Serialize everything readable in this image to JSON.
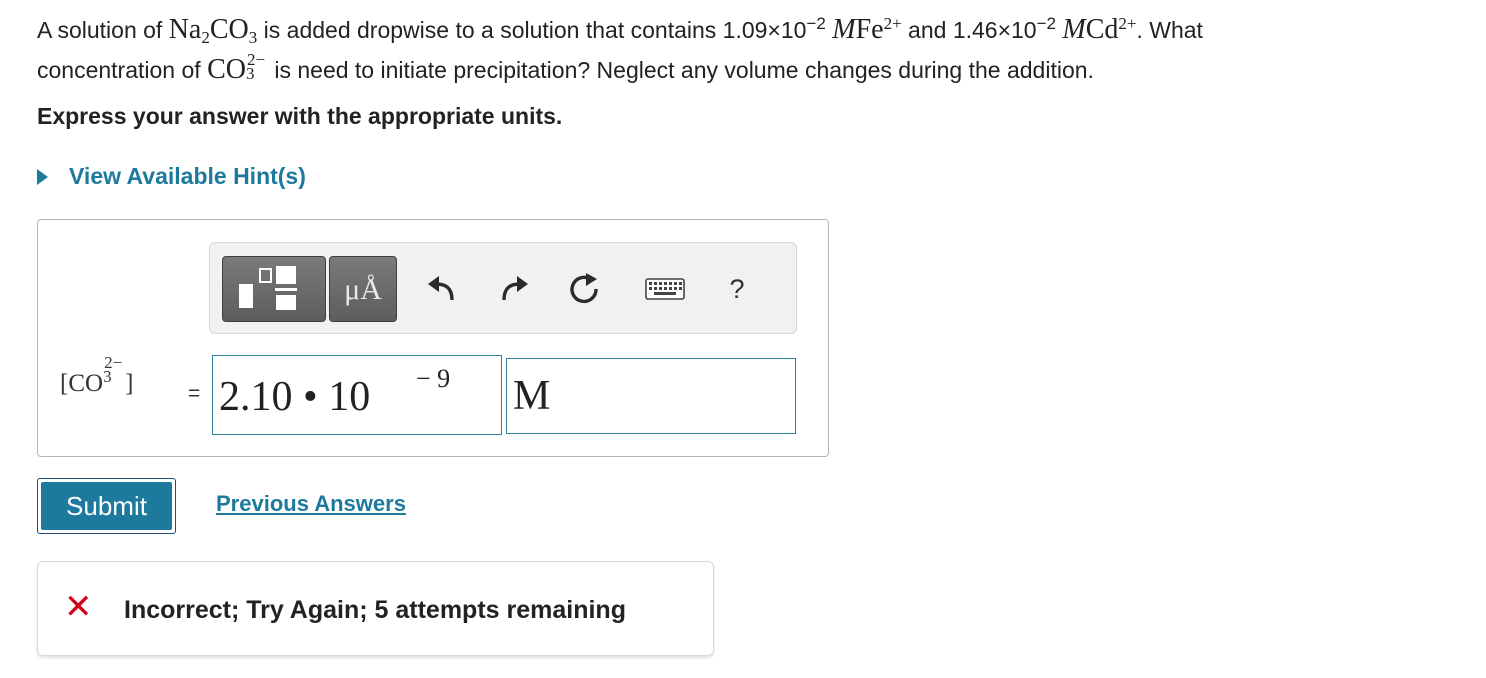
{
  "question": {
    "p1": "A solution of ",
    "na2": "Na",
    "na2_sub": "2",
    "co3": "CO",
    "co3_sub": "3",
    "p2": " is added dropwise to a solution that contains ",
    "fe_conc": "1.09×10",
    "fe_exp": "−2",
    "unit_m1": "M",
    "fe": "Fe",
    "fe_charge": "2+",
    "p3": " and ",
    "cd_conc": "1.46×10",
    "cd_exp": "−2",
    "unit_m2": "M",
    "cd": "Cd",
    "cd_charge": "2+",
    "p4": ". What",
    "p5": "concentration of ",
    "co3b": "CO",
    "co3b_sub": "3",
    "co3b_charge": "2−",
    "p6": " is need to initiate precipitation? Neglect any volume changes during the addition."
  },
  "instruction": "Express your answer with the appropriate units.",
  "hint_link": "View Available Hint(s)",
  "toolbar": {
    "unit_button": "μÅ",
    "help_label": "?",
    "icons": [
      "templates-icon",
      "units-icon",
      "undo-icon",
      "redo-icon",
      "reset-icon",
      "keyboard-icon",
      "help-icon"
    ]
  },
  "answer": {
    "lhs_open": "[CO",
    "lhs_sub": "3",
    "lhs_charge": "2−",
    "lhs_close": "]",
    "equals": "=",
    "value": "2.10 • 10",
    "exponent": "− 9",
    "unit": "M"
  },
  "submit_label": "Submit",
  "previous_answers_label": "Previous Answers",
  "feedback": {
    "icon": "✕",
    "message": "Incorrect; Try Again; 5 attempts remaining"
  },
  "colors": {
    "link": "#1d7a9c",
    "submit_bg": "#1d7a9c",
    "error": "#d0021b"
  }
}
